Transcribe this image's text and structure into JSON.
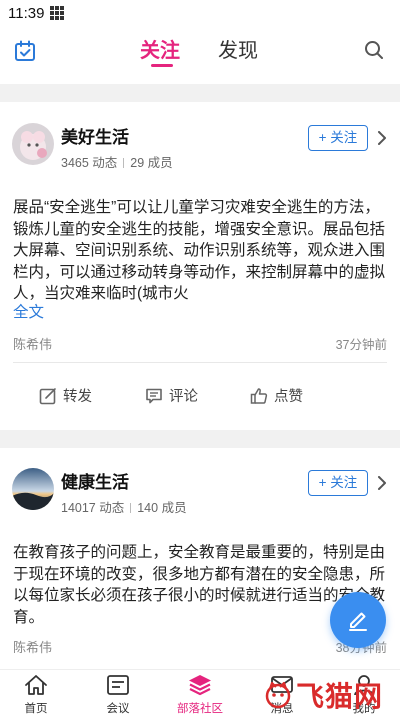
{
  "status_bar": {
    "time": "11:39"
  },
  "top_nav": {
    "tabs": [
      {
        "label": "关注",
        "active": true
      },
      {
        "label": "发现",
        "active": false
      }
    ]
  },
  "posts": [
    {
      "group_name": "美好生活",
      "dynamic_count": "3465 动态",
      "member_count": "29 成员",
      "follow_label": "+ 关注",
      "content": "展品“安全逃生”可以让儿童学习灾难安全逃生的方法，锻炼儿童的安全逃生的技能，增强安全意识。展品包括大屏幕、空间识别系统、动作识别系统等，观众进入围栏内，可以通过移动转身等动作，来控制屏幕中的虚拟人，当灾难来临时(城市火",
      "full_text_label": "全文",
      "author": "陈希伟",
      "time": "37分钟前",
      "actions": {
        "repost": "转发",
        "comment": "评论",
        "like": "点赞"
      }
    },
    {
      "group_name": "健康生活",
      "dynamic_count": "14017 动态",
      "member_count": "140 成员",
      "follow_label": "+ 关注",
      "content": "在教育孩子的问题上，安全教育是最重要的，特别是由于现在环境的改变，很多地方都有潜在的安全隐患，所以每位家长必须在孩子很小的时候就进行适当的安全教育。",
      "author": "陈希伟",
      "time": "38分钟前"
    }
  ],
  "bottom_nav": [
    {
      "label": "首页"
    },
    {
      "label": "会议"
    },
    {
      "label": "部落社区",
      "active": true
    },
    {
      "label": "消息"
    },
    {
      "label": "我的"
    }
  ],
  "watermark": {
    "text": "飞猫网"
  },
  "colors": {
    "accent": "#e5247e",
    "link": "#2b7ad9",
    "fab": "#3a8ef0"
  },
  "icons": [
    "calendar-icon",
    "search-icon",
    "chevron-right-icon",
    "share-icon",
    "comment-icon",
    "thumbs-up-icon",
    "edit-icon",
    "home-icon",
    "meeting-icon",
    "community-icon",
    "message-icon",
    "profile-icon"
  ]
}
